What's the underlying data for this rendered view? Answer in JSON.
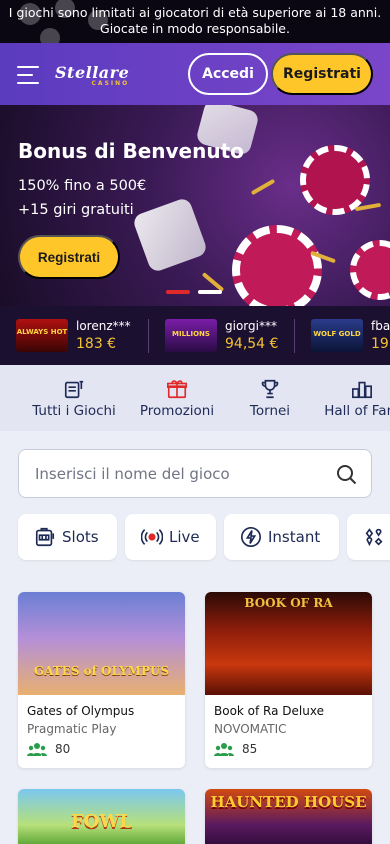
{
  "notice": {
    "line1": "I giochi sono limitati ai giocatori di età superiore ai 18 anni.",
    "line2": "Giocate in modo responsabile."
  },
  "header": {
    "logo": "Stellare",
    "logo_sub": "CASINO",
    "login_label": "Accedi",
    "register_label": "Registrati"
  },
  "banner": {
    "title": "Bonus di Benvenuto",
    "line1": "150% fino a 500€",
    "line2": "+15 giri gratuiti",
    "button": "Registrati",
    "slides": 2,
    "active_slide": 1
  },
  "winners": [
    {
      "user": "lorenz***",
      "amount": "183 €",
      "game_art": "ALWAYS HOT"
    },
    {
      "user": "giorgi***",
      "amount": "94,54 €",
      "game_art": "MILLIONS"
    },
    {
      "user": "fba",
      "amount": "19",
      "game_art": "WOLF GOLD"
    }
  ],
  "nav": [
    {
      "label": "Tutti i Giochi",
      "icon": "games-icon"
    },
    {
      "label": "Promozioni",
      "icon": "gift-icon"
    },
    {
      "label": "Tornei",
      "icon": "trophy-icon"
    },
    {
      "label": "Hall of Fam",
      "icon": "leaderboard-icon"
    }
  ],
  "search": {
    "placeholder": "Inserisci il nome del gioco"
  },
  "categories": [
    {
      "label": "Slots",
      "icon": "slot-machine-icon"
    },
    {
      "label": "Live",
      "icon": "live-icon"
    },
    {
      "label": "Instant",
      "icon": "lightning-icon"
    },
    {
      "label": "",
      "icon": "cards-icon"
    }
  ],
  "games": [
    {
      "title": "Gates of Olympus",
      "provider": "Pragmatic Play",
      "players": "80",
      "art_text": "GATES of OLYMPUS"
    },
    {
      "title": "Book of Ra Deluxe",
      "provider": "NOVOMATIC",
      "players": "85",
      "art_text": "BOOK OF RA"
    },
    {
      "title": "",
      "provider": "",
      "players": "",
      "art_text": "FOWL"
    },
    {
      "title": "",
      "provider": "",
      "players": "",
      "art_text": "HAUNTED HOUSE"
    }
  ],
  "colors": {
    "accent_yellow": "#ffc629",
    "header_purple": "#6a41c4",
    "ticker_bg": "#1c1030",
    "amount_gold": "#f2c230",
    "nav_text": "#1e2a55",
    "dot_active": "#e02a2a"
  }
}
